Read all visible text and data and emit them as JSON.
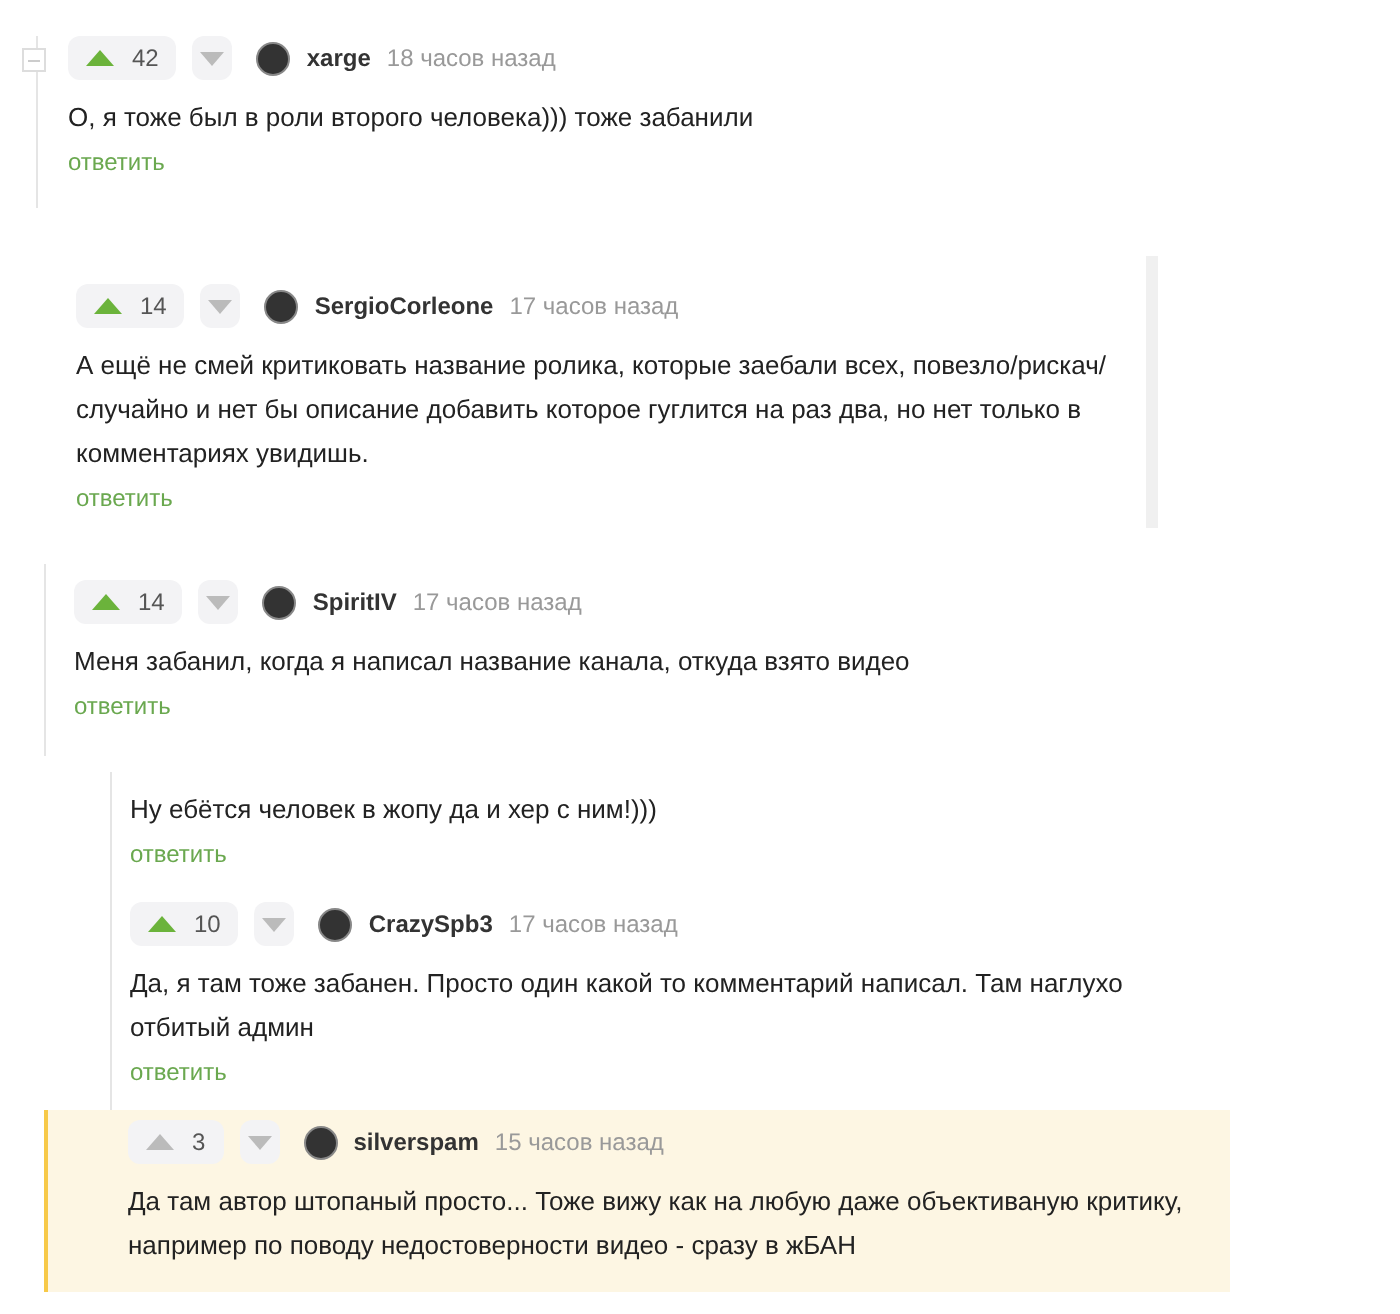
{
  "comments": [
    {
      "author": "xarge",
      "time": "18 часов назад",
      "rating": "42",
      "upvoted": true,
      "highlighted": false,
      "text": "О, я тоже был в роли второго человека))) тоже забанили",
      "reply": "ответить"
    },
    {
      "author": "SergioCorleone",
      "time": "17 часов назад",
      "rating": "14",
      "upvoted": true,
      "highlighted": false,
      "text": "А ещё не смей критиковать название ролика, которые заебали всех, повезло/рискач/ случайно и нет бы описание добавить которое гуглится на раз два, но нет только в комментариях увидишь.",
      "reply": "ответить"
    },
    {
      "author": "SpiritIV",
      "time": "17 часов назад",
      "rating": "14",
      "upvoted": true,
      "highlighted": false,
      "text": "Меня забанил, когда я написал название канала, откуда взято видео",
      "reply": "ответить"
    },
    {
      "text": "Ну ебётся человек в жопу да и хер с ним!)))",
      "reply": "ответить",
      "highlighted": false
    },
    {
      "author": "CrazySpb3",
      "time": "17 часов назад",
      "rating": "10",
      "upvoted": true,
      "highlighted": false,
      "text": "Да, я там тоже забанен. Просто один какой то комментарий написал. Там наглухо отбитый админ",
      "reply": "ответить"
    },
    {
      "author": "silverspam",
      "time": "15 часов назад",
      "rating": "3",
      "upvoted": false,
      "highlighted": true,
      "text": "Да там автор штопаный просто... Тоже вижу как на любую даже объективаную критику, например по поводу недостоверности видео - сразу в жБАН"
    }
  ]
}
